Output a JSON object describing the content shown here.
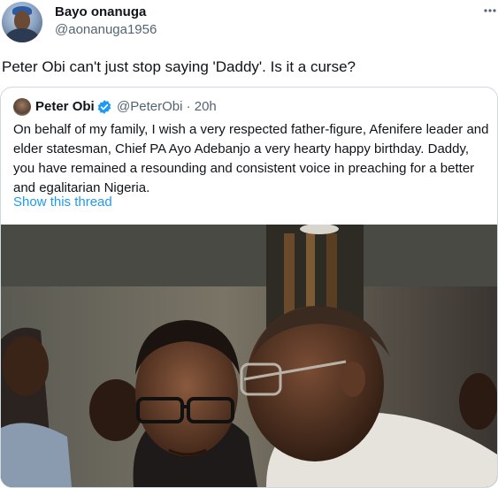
{
  "author": {
    "name": "Bayo onanuga",
    "handle": "@aonanuga1956"
  },
  "menu_icon": "more-horizontal-icon",
  "tweet": {
    "text": "Peter Obi can't just stop saying 'Daddy'. Is it a curse?"
  },
  "quoted_tweet": {
    "author_name": "Peter Obi",
    "verified_icon": "verified-badge-icon",
    "handle_time": "@PeterObi · 20h",
    "text": "On behalf of my family, I wish a very respected father-figure, Afenifere leader and elder statesman, Chief PA Ayo Adebanjo a very hearty happy birthday. Daddy, you have remained a resounding and consistent voice  in preaching for a better and egalitarian Nigeria.",
    "show_thread_label": "Show this thread"
  },
  "colors": {
    "text": "#0f1419",
    "secondary": "#536471",
    "link": "#1d9bf0",
    "border": "#cfd9de"
  }
}
